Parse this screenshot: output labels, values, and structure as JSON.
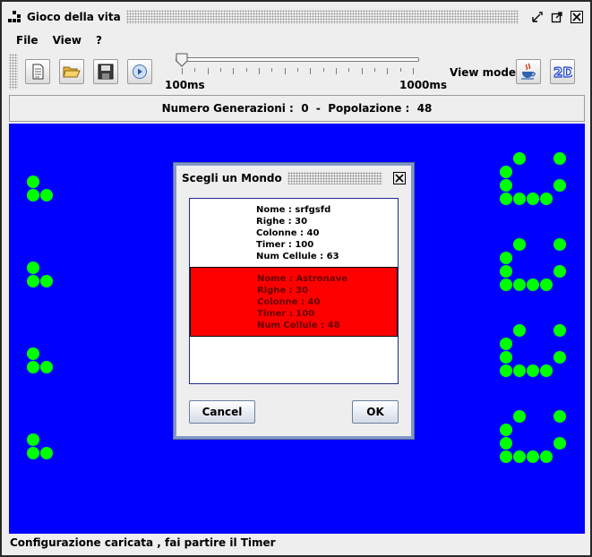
{
  "window": {
    "title": "Gioco della vita"
  },
  "menu": {
    "items": [
      "File",
      "View",
      "?"
    ]
  },
  "toolbar": {
    "slider_min_label": "100ms",
    "slider_max_label": "1000ms",
    "timer_value_ms": 100,
    "view_mode_label": "View mode"
  },
  "stats": {
    "generations_label": "Numero Generazioni :",
    "generations_value": "0",
    "separator": "-",
    "population_label": "Popolazione :",
    "population_value": "48"
  },
  "status": {
    "message": "Configurazione caricata , fai partire il Timer"
  },
  "dialog": {
    "title": "Scegli un Mondo",
    "worlds": [
      {
        "name": "Nome : srfgsfd",
        "rows": "Righe : 30",
        "cols": "Colonne : 40",
        "timer": "Timer : 100",
        "cells": "Num Cellule : 63",
        "selected": false
      },
      {
        "name": "Nome : Astronave",
        "rows": "Righe : 30",
        "cols": "Colonne : 40",
        "timer": "Timer : 100",
        "cells": "Num Cellule : 48",
        "selected": true
      }
    ],
    "cancel_label": "Cancel",
    "ok_label": "OK"
  },
  "colors": {
    "grid_background": "#0000fe",
    "live_cell": "#00ff00",
    "selected_row": "#ff0000"
  }
}
